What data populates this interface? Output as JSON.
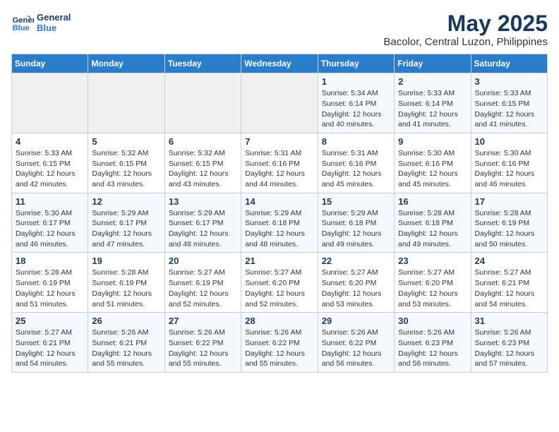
{
  "logo": {
    "line1": "General",
    "line2": "Blue"
  },
  "title": "May 2025",
  "subtitle": "Bacolor, Central Luzon, Philippines",
  "days_of_week": [
    "Sunday",
    "Monday",
    "Tuesday",
    "Wednesday",
    "Thursday",
    "Friday",
    "Saturday"
  ],
  "weeks": [
    [
      {
        "num": "",
        "info": ""
      },
      {
        "num": "",
        "info": ""
      },
      {
        "num": "",
        "info": ""
      },
      {
        "num": "",
        "info": ""
      },
      {
        "num": "1",
        "info": "Sunrise: 5:34 AM\nSunset: 6:14 PM\nDaylight: 12 hours\nand 40 minutes."
      },
      {
        "num": "2",
        "info": "Sunrise: 5:33 AM\nSunset: 6:14 PM\nDaylight: 12 hours\nand 41 minutes."
      },
      {
        "num": "3",
        "info": "Sunrise: 5:33 AM\nSunset: 6:15 PM\nDaylight: 12 hours\nand 41 minutes."
      }
    ],
    [
      {
        "num": "4",
        "info": "Sunrise: 5:33 AM\nSunset: 6:15 PM\nDaylight: 12 hours\nand 42 minutes."
      },
      {
        "num": "5",
        "info": "Sunrise: 5:32 AM\nSunset: 6:15 PM\nDaylight: 12 hours\nand 43 minutes."
      },
      {
        "num": "6",
        "info": "Sunrise: 5:32 AM\nSunset: 6:15 PM\nDaylight: 12 hours\nand 43 minutes."
      },
      {
        "num": "7",
        "info": "Sunrise: 5:31 AM\nSunset: 6:16 PM\nDaylight: 12 hours\nand 44 minutes."
      },
      {
        "num": "8",
        "info": "Sunrise: 5:31 AM\nSunset: 6:16 PM\nDaylight: 12 hours\nand 45 minutes."
      },
      {
        "num": "9",
        "info": "Sunrise: 5:30 AM\nSunset: 6:16 PM\nDaylight: 12 hours\nand 45 minutes."
      },
      {
        "num": "10",
        "info": "Sunrise: 5:30 AM\nSunset: 6:16 PM\nDaylight: 12 hours\nand 46 minutes."
      }
    ],
    [
      {
        "num": "11",
        "info": "Sunrise: 5:30 AM\nSunset: 6:17 PM\nDaylight: 12 hours\nand 46 minutes."
      },
      {
        "num": "12",
        "info": "Sunrise: 5:29 AM\nSunset: 6:17 PM\nDaylight: 12 hours\nand 47 minutes."
      },
      {
        "num": "13",
        "info": "Sunrise: 5:29 AM\nSunset: 6:17 PM\nDaylight: 12 hours\nand 48 minutes."
      },
      {
        "num": "14",
        "info": "Sunrise: 5:29 AM\nSunset: 6:18 PM\nDaylight: 12 hours\nand 48 minutes."
      },
      {
        "num": "15",
        "info": "Sunrise: 5:29 AM\nSunset: 6:18 PM\nDaylight: 12 hours\nand 49 minutes."
      },
      {
        "num": "16",
        "info": "Sunrise: 5:28 AM\nSunset: 6:18 PM\nDaylight: 12 hours\nand 49 minutes."
      },
      {
        "num": "17",
        "info": "Sunrise: 5:28 AM\nSunset: 6:19 PM\nDaylight: 12 hours\nand 50 minutes."
      }
    ],
    [
      {
        "num": "18",
        "info": "Sunrise: 5:28 AM\nSunset: 6:19 PM\nDaylight: 12 hours\nand 51 minutes."
      },
      {
        "num": "19",
        "info": "Sunrise: 5:28 AM\nSunset: 6:19 PM\nDaylight: 12 hours\nand 51 minutes."
      },
      {
        "num": "20",
        "info": "Sunrise: 5:27 AM\nSunset: 6:19 PM\nDaylight: 12 hours\nand 52 minutes."
      },
      {
        "num": "21",
        "info": "Sunrise: 5:27 AM\nSunset: 6:20 PM\nDaylight: 12 hours\nand 52 minutes."
      },
      {
        "num": "22",
        "info": "Sunrise: 5:27 AM\nSunset: 6:20 PM\nDaylight: 12 hours\nand 53 minutes."
      },
      {
        "num": "23",
        "info": "Sunrise: 5:27 AM\nSunset: 6:20 PM\nDaylight: 12 hours\nand 53 minutes."
      },
      {
        "num": "24",
        "info": "Sunrise: 5:27 AM\nSunset: 6:21 PM\nDaylight: 12 hours\nand 54 minutes."
      }
    ],
    [
      {
        "num": "25",
        "info": "Sunrise: 5:27 AM\nSunset: 6:21 PM\nDaylight: 12 hours\nand 54 minutes."
      },
      {
        "num": "26",
        "info": "Sunrise: 5:26 AM\nSunset: 6:21 PM\nDaylight: 12 hours\nand 55 minutes."
      },
      {
        "num": "27",
        "info": "Sunrise: 5:26 AM\nSunset: 6:22 PM\nDaylight: 12 hours\nand 55 minutes."
      },
      {
        "num": "28",
        "info": "Sunrise: 5:26 AM\nSunset: 6:22 PM\nDaylight: 12 hours\nand 55 minutes."
      },
      {
        "num": "29",
        "info": "Sunrise: 5:26 AM\nSunset: 6:22 PM\nDaylight: 12 hours\nand 56 minutes."
      },
      {
        "num": "30",
        "info": "Sunrise: 5:26 AM\nSunset: 6:23 PM\nDaylight: 12 hours\nand 56 minutes."
      },
      {
        "num": "31",
        "info": "Sunrise: 5:26 AM\nSunset: 6:23 PM\nDaylight: 12 hours\nand 57 minutes."
      }
    ]
  ]
}
